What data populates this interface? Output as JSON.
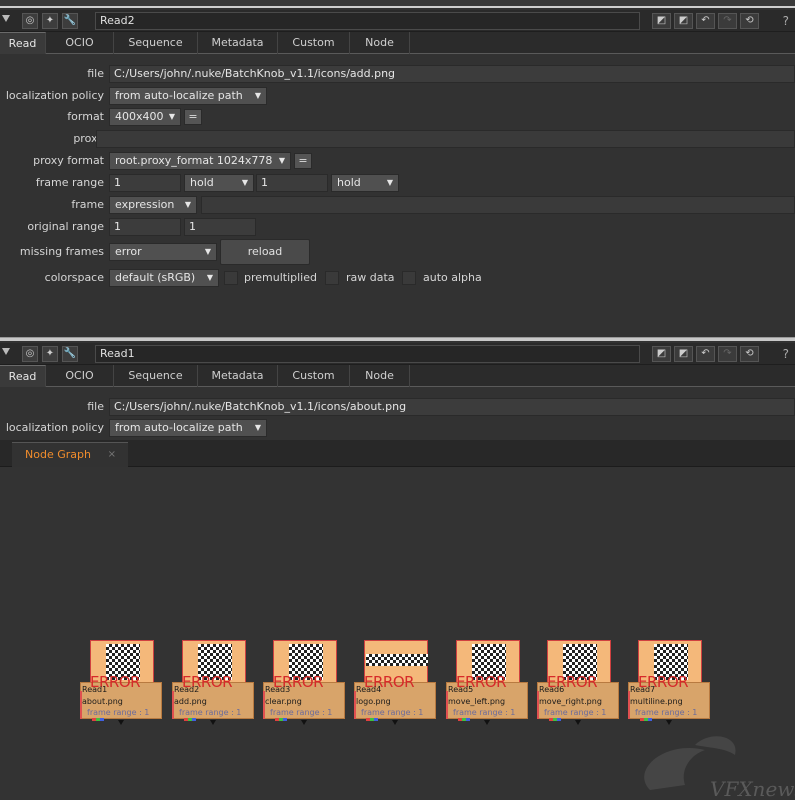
{
  "panels": [
    {
      "node_name": "Read2",
      "tabs": [
        "Read",
        "OCIO",
        "Sequence",
        "Metadata",
        "Custom",
        "Node"
      ],
      "file_label": "file",
      "file_value": "C:/Users/john/.nuke/BatchKnob_v1.1/icons/add.png",
      "localization_label": "localization policy",
      "localization_value": "from auto-localize path",
      "format_label": "format",
      "format_value": "400x400",
      "proxy_label": "proxy",
      "proxy_format_label": "proxy format",
      "proxy_format_value": "root.proxy_format 1024x778",
      "frame_range_label": "frame range",
      "frame_range_first": "1",
      "frame_range_before": "hold",
      "frame_range_last": "1",
      "frame_range_after": "hold",
      "frame_label": "frame",
      "frame_mode": "expression",
      "original_range_label": "original range",
      "original_range_first": "1",
      "original_range_last": "1",
      "missing_frames_label": "missing frames",
      "missing_frames_value": "error",
      "reload_label": "reload",
      "colorspace_label": "colorspace",
      "colorspace_value": "default (sRGB)",
      "premultiplied_label": "premultiplied",
      "raw_data_label": "raw data",
      "auto_alpha_label": "auto alpha",
      "equals_label": "="
    },
    {
      "node_name": "Read1",
      "tabs": [
        "Read",
        "OCIO",
        "Sequence",
        "Metadata",
        "Custom",
        "Node"
      ],
      "file_label": "file",
      "file_value": "C:/Users/john/.nuke/BatchKnob_v1.1/icons/about.png",
      "localization_label": "localization policy",
      "localization_value": "from auto-localize path"
    }
  ],
  "titlebar_help": "?",
  "node_graph": {
    "tab_label": "Node Graph",
    "close_glyph": "×",
    "nodes": [
      {
        "name": "Read1",
        "file": "about.png",
        "error": "ERROR",
        "frame_range": "frame range : 1"
      },
      {
        "name": "Read2",
        "file": "add.png",
        "error": "ERROR",
        "frame_range": "frame range : 1"
      },
      {
        "name": "Read3",
        "file": "clear.png",
        "error": "ERROR",
        "frame_range": "frame range : 1"
      },
      {
        "name": "Read4",
        "file": "logo.png",
        "error": "ERROR",
        "frame_range": "frame range : 1"
      },
      {
        "name": "Read5",
        "file": "move_left.png",
        "error": "ERROR",
        "frame_range": "frame range : 1"
      },
      {
        "name": "Read6",
        "file": "move_right.png",
        "error": "ERROR",
        "frame_range": "frame range : 1"
      },
      {
        "name": "Read7",
        "file": "multiline.png",
        "error": "ERROR",
        "frame_range": "frame range : 1"
      }
    ]
  },
  "watermark": "VFXnews",
  "icons": [
    "collapse-arrow-icon",
    "viewer-icon",
    "node-color-icon",
    "wrench-icon",
    "undo-icon",
    "redo-icon",
    "revert-icon",
    "help-icon"
  ]
}
